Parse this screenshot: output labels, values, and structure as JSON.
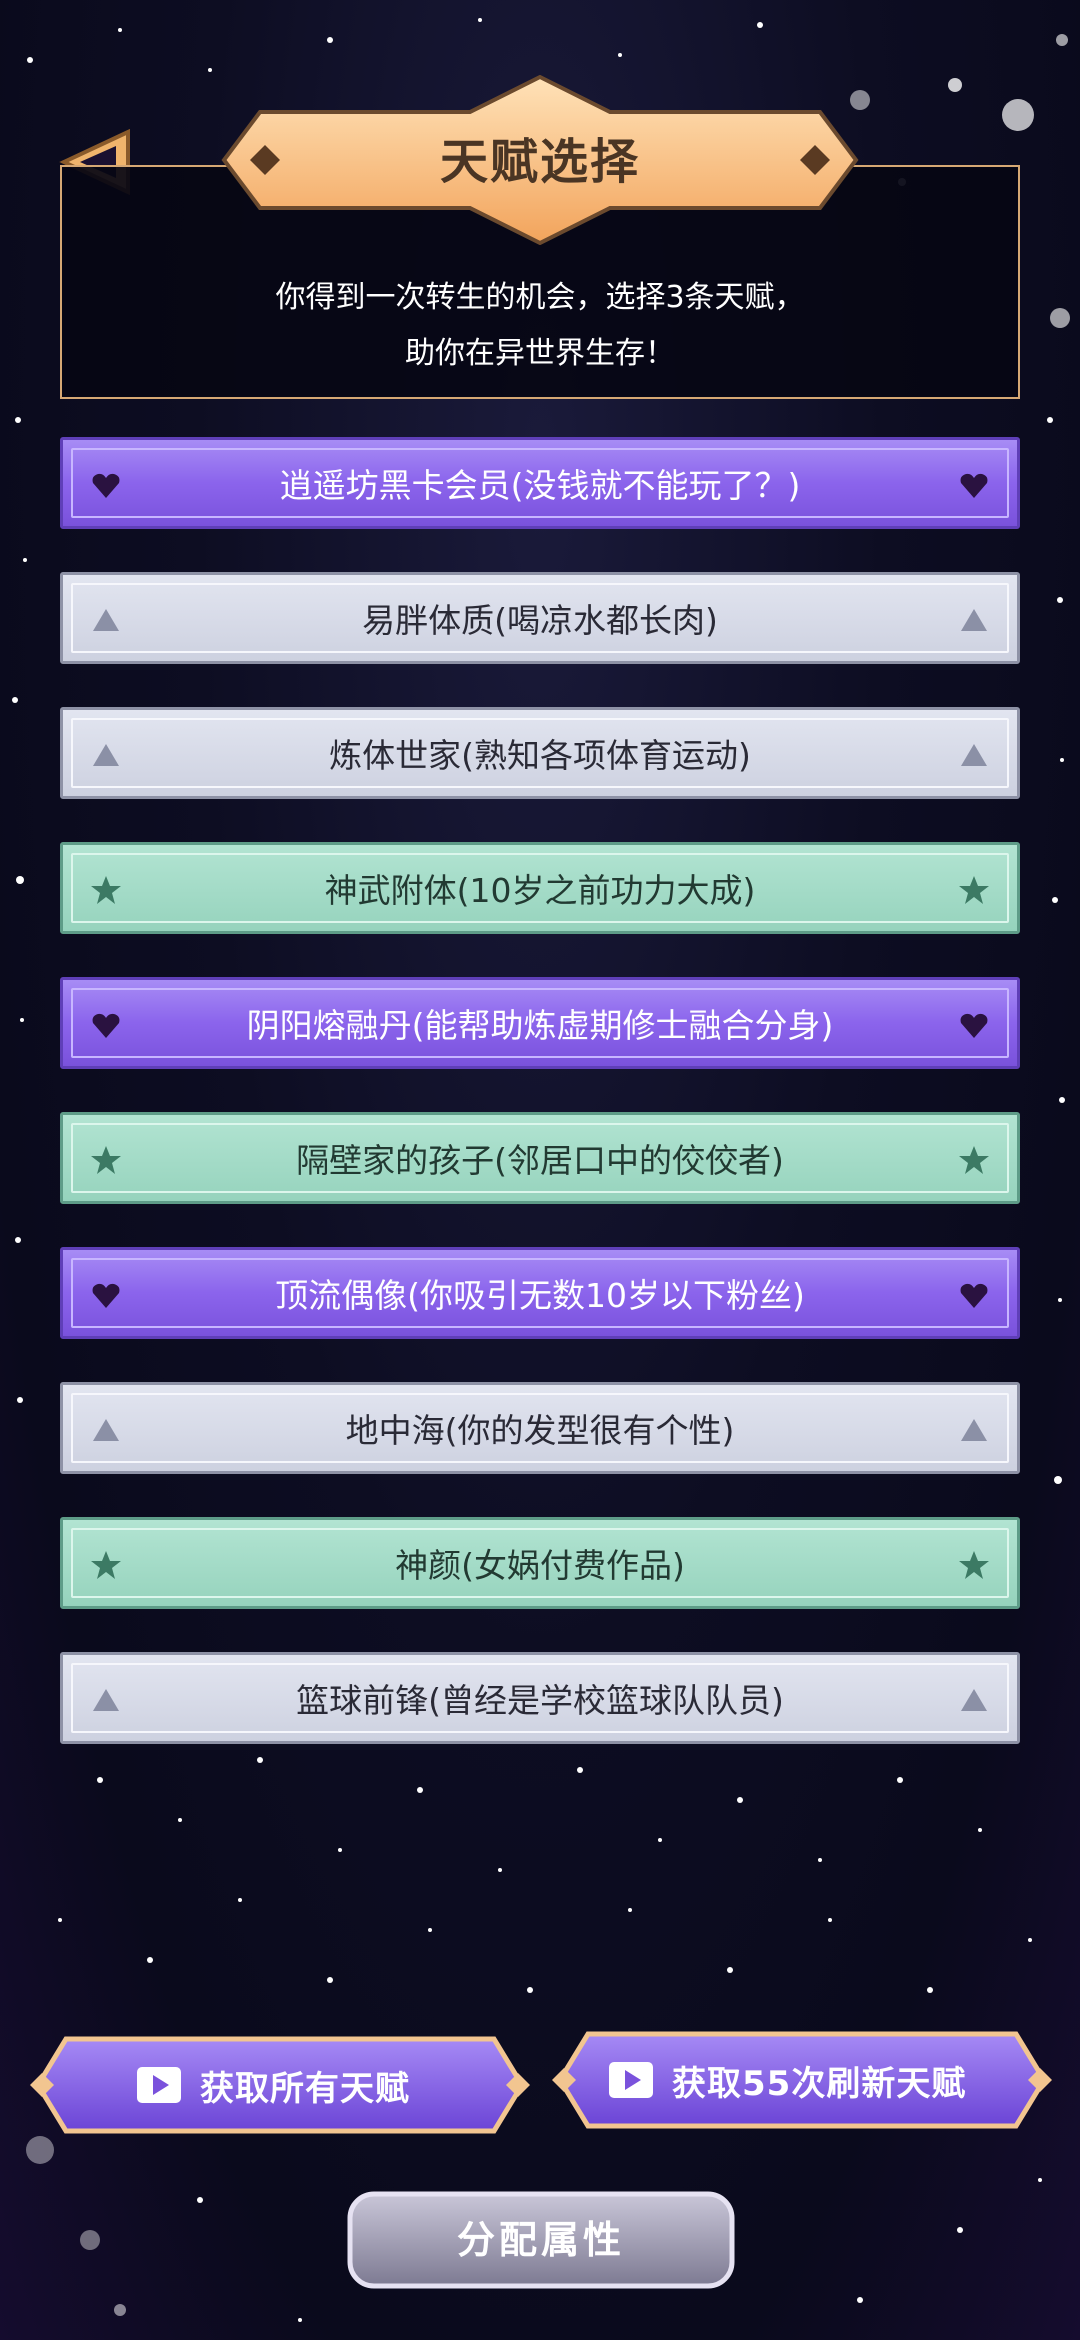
{
  "header": {
    "title": "天赋选择",
    "intro_line1": "你得到一次转生的机会，选择3条天赋，",
    "intro_line2": "助你在异世界生存！"
  },
  "talents": [
    {
      "label": "逍遥坊黑卡会员(没钱就不能玩了？)",
      "rarity": "purple",
      "icon": "heart-gem-icon"
    },
    {
      "label": "易胖体质(喝凉水都长肉)",
      "rarity": "gray",
      "icon": "triangle-icon"
    },
    {
      "label": "炼体世家(熟知各项体育运动)",
      "rarity": "gray",
      "icon": "triangle-icon"
    },
    {
      "label": "神武附体(10岁之前功力大成)",
      "rarity": "green",
      "icon": "star-icon"
    },
    {
      "label": "阴阳熔融丹(能帮助炼虚期修士融合分身)",
      "rarity": "purple",
      "icon": "heart-gem-icon"
    },
    {
      "label": "隔壁家的孩子(邻居口中的佼佼者)",
      "rarity": "green",
      "icon": "star-icon"
    },
    {
      "label": "顶流偶像(你吸引无数10岁以下粉丝)",
      "rarity": "purple",
      "icon": "heart-gem-icon"
    },
    {
      "label": "地中海(你的发型很有个性)",
      "rarity": "gray",
      "icon": "triangle-icon"
    },
    {
      "label": "神颜(女娲付费作品)",
      "rarity": "green",
      "icon": "star-icon"
    },
    {
      "label": "篮球前锋(曾经是学校篮球队队员)",
      "rarity": "gray",
      "icon": "triangle-icon"
    }
  ],
  "actions": {
    "get_all": "获取所有天赋",
    "refresh": "获取55次刷新天赋",
    "assign": "分配属性"
  },
  "colors": {
    "purple": "#8b64ec",
    "gray": "#cdd1e0",
    "green": "#96d3bd",
    "banner": "#f7c48a",
    "frame": "#d6a874"
  }
}
